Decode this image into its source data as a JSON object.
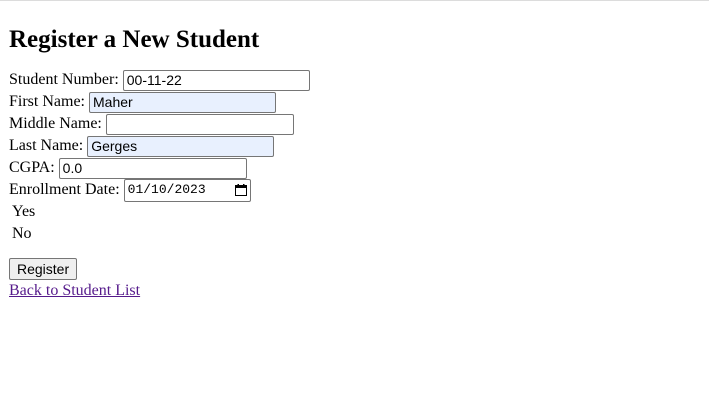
{
  "page": {
    "title": "Register a New Student"
  },
  "form": {
    "student_number": {
      "label": "Student Number:",
      "value": "00-11-22"
    },
    "first_name": {
      "label": "First Name:",
      "value": "Maher"
    },
    "middle_name": {
      "label": "Middle Name:",
      "value": ""
    },
    "last_name": {
      "label": "Last Name:",
      "value": "Gerges"
    },
    "cgpa": {
      "label": "CGPA:",
      "value": "0.0"
    },
    "enrollment_date": {
      "label": "Enrollment Date:",
      "value": "01/10/2023",
      "icon": "calendar-icon"
    },
    "options": [
      {
        "label": "Yes"
      },
      {
        "label": "No"
      }
    ],
    "register_label": "Register"
  },
  "links": {
    "back_label": "Back to Student List"
  },
  "colors": {
    "autofill_bg": "#e8f0fe",
    "visited_link": "#551a8b",
    "button_bg": "#efefef",
    "input_border": "#767676"
  }
}
